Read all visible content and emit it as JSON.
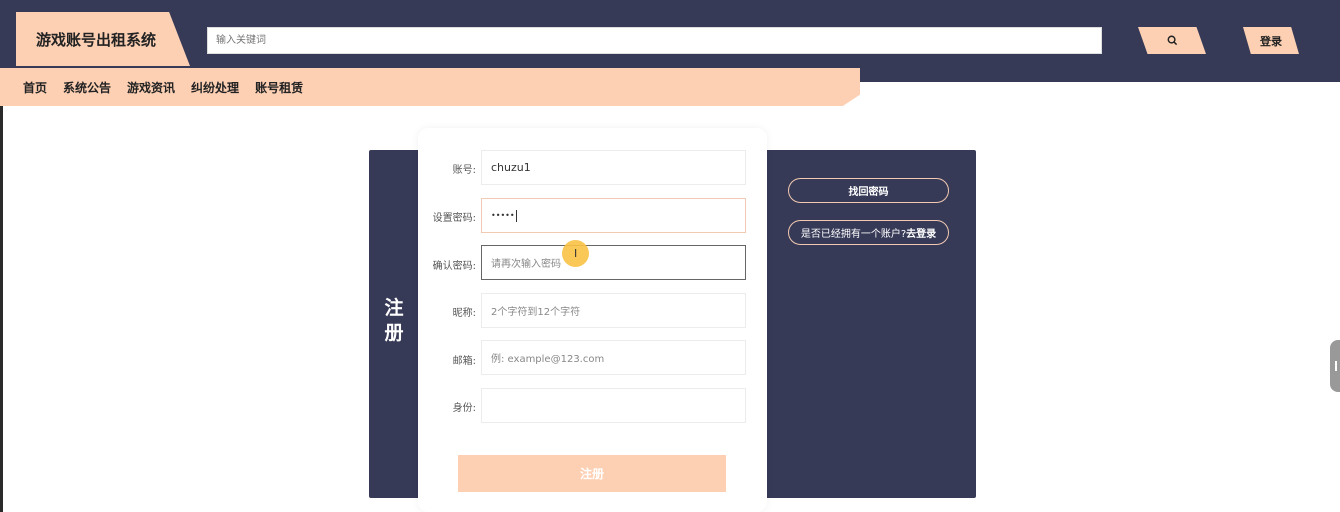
{
  "header": {
    "brand": "游戏账号出租系统",
    "search_placeholder": "输入关键词",
    "search_icon": "search-icon",
    "login_label": "登录"
  },
  "nav": {
    "items": [
      {
        "label": "首页"
      },
      {
        "label": "系统公告"
      },
      {
        "label": "游戏资讯"
      },
      {
        "label": "纠纷处理"
      },
      {
        "label": "账号租赁"
      }
    ]
  },
  "register": {
    "title": "注册",
    "fields": [
      {
        "label": "账号:",
        "value": "chuzu1",
        "placeholder": ""
      },
      {
        "label": "设置密码:",
        "value": "•••••",
        "placeholder": ""
      },
      {
        "label": "确认密码:",
        "value": "",
        "placeholder": "请再次输入密码"
      },
      {
        "label": "昵称:",
        "value": "",
        "placeholder": "2个字符到12个字符"
      },
      {
        "label": "邮箱:",
        "value": "",
        "placeholder": "例: example@123.com"
      },
      {
        "label": "身份:",
        "value": "",
        "placeholder": ""
      }
    ],
    "submit_label": "注册"
  },
  "side_links": {
    "recover": "找回密码",
    "has_account": "是否已经拥有一个账户?",
    "go_login": "去登录"
  },
  "colors": {
    "dark": "#363a57",
    "accent": "#fdd0b4"
  }
}
